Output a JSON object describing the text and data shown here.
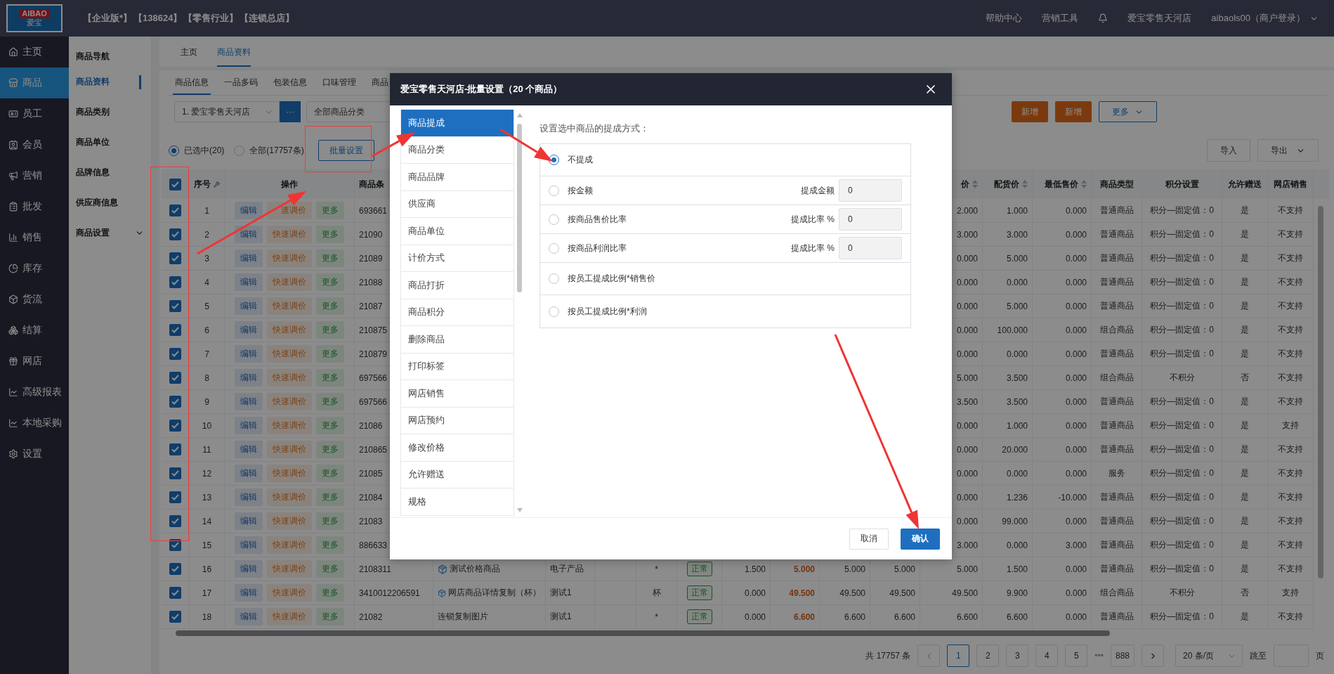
{
  "logo": {
    "text": "AIBAO",
    "subtext": "爱宝"
  },
  "header": {
    "badges": [
      "【企业版*】",
      "【138624】",
      "【零售行业】",
      "【连锁总店】"
    ],
    "links": [
      "帮助中心",
      "营销工具"
    ],
    "store": "爱宝零售天河店",
    "user": "aibaols00（商户登录）"
  },
  "sidebar": {
    "items": [
      {
        "label": "主页",
        "selected": false
      },
      {
        "label": "商品",
        "selected": true
      },
      {
        "label": "员工",
        "selected": false
      },
      {
        "label": "会员",
        "selected": false
      },
      {
        "label": "营销",
        "selected": false
      },
      {
        "label": "批发",
        "selected": false
      },
      {
        "label": "销售",
        "selected": false
      },
      {
        "label": "库存",
        "selected": false
      },
      {
        "label": "货流",
        "selected": false
      },
      {
        "label": "结算",
        "selected": false
      },
      {
        "label": "网店",
        "selected": false
      },
      {
        "label": "高级报表",
        "selected": false
      },
      {
        "label": "本地采购",
        "selected": false
      },
      {
        "label": "设置",
        "selected": false
      }
    ]
  },
  "subnav": {
    "title": "商品导航",
    "items": [
      {
        "label": "商品资料",
        "selected": true,
        "has_children": false
      },
      {
        "label": "商品类别",
        "selected": false,
        "has_children": false
      },
      {
        "label": "商品单位",
        "selected": false,
        "has_children": false
      },
      {
        "label": "品牌信息",
        "selected": false,
        "has_children": false
      },
      {
        "label": "供应商信息",
        "selected": false,
        "has_children": false
      },
      {
        "label": "商品设置",
        "selected": false,
        "has_children": true
      }
    ]
  },
  "page_tabs": [
    {
      "label": "主页",
      "selected": false
    },
    {
      "label": "商品资料",
      "selected": true
    }
  ],
  "inner_tabs": [
    {
      "label": "商品信息",
      "selected": true
    },
    {
      "label": "一品多码",
      "selected": false
    },
    {
      "label": "包装信息",
      "selected": false
    },
    {
      "label": "口味管理",
      "selected": false
    },
    {
      "label": "商品",
      "selected": false
    }
  ],
  "filters": {
    "store_select": "1. 爱宝零售天河店",
    "more_button": "···",
    "category_select": "全部商品分类"
  },
  "action_buttons": [
    {
      "label": "新增",
      "kind": "primary"
    },
    {
      "label": "新增",
      "kind": "primary"
    },
    {
      "label": "更多",
      "kind": "dropdown"
    }
  ],
  "scope": [
    {
      "label": "已选中(20)",
      "selected": true
    },
    {
      "label": "全部(17757条)",
      "selected": false
    }
  ],
  "batch_button": "批量设置",
  "io_buttons": [
    {
      "label": "导入",
      "kind": "plain"
    },
    {
      "label": "导出",
      "kind": "dropdown"
    }
  ],
  "table": {
    "all_checked": true,
    "columns": [
      {
        "label": "序号",
        "kind": "seq"
      },
      {
        "label": "操作",
        "kind": "ops"
      },
      {
        "label": "商品条",
        "kind": "text"
      },
      {
        "kind": "name"
      },
      {
        "kind": "text"
      },
      {
        "kind": "text"
      },
      {
        "kind": "center"
      },
      {
        "kind": "status"
      },
      {
        "kind": "num"
      },
      {
        "kind": "strong"
      },
      {
        "kind": "num"
      },
      {
        "kind": "num"
      },
      {
        "label": "价",
        "kind": "num",
        "sortable": true
      },
      {
        "label": "配货价",
        "kind": "num",
        "sortable": true
      },
      {
        "label": "最低售价",
        "kind": "num",
        "sortable": true
      },
      {
        "label": "商品类型",
        "kind": "center"
      },
      {
        "label": "积分设置",
        "kind": "center"
      },
      {
        "label": "允许赠送",
        "kind": "center"
      },
      {
        "label": "网店销售",
        "kind": "center"
      }
    ],
    "rows": [
      {
        "checked": true,
        "seq": "1",
        "ops": [
          "编辑",
          "速调价",
          "更多"
        ],
        "barcode": "693661",
        "price": "2.000",
        "dist": "1.000",
        "min": "0.000",
        "type": "普通商品",
        "points": "积分—固定值：0",
        "gift": "是",
        "online": "不支持"
      },
      {
        "checked": true,
        "seq": "2",
        "ops": [
          "编辑",
          "快速调价",
          "更多"
        ],
        "barcode": "21090",
        "price": "3.000",
        "dist": "3.000",
        "min": "0.000",
        "type": "普通商品",
        "points": "积分—固定值：0",
        "gift": "是",
        "online": "不支持"
      },
      {
        "checked": true,
        "seq": "3",
        "ops": [
          "编辑",
          "快速调价",
          "更多"
        ],
        "barcode": "21089",
        "price": "0.000",
        "dist": "5.000",
        "min": "0.000",
        "type": "普通商品",
        "points": "积分—固定值：0",
        "gift": "是",
        "online": "不支持"
      },
      {
        "checked": true,
        "seq": "4",
        "ops": [
          "编辑",
          "快速调价",
          "更多"
        ],
        "barcode": "21088",
        "price": "0.000",
        "dist": "0.000",
        "min": "0.000",
        "type": "普通商品",
        "points": "积分—固定值：0",
        "gift": "是",
        "online": "不支持"
      },
      {
        "checked": true,
        "seq": "5",
        "ops": [
          "编辑",
          "快速调价",
          "更多"
        ],
        "barcode": "21087",
        "price": "0.000",
        "dist": "5.000",
        "min": "0.000",
        "type": "普通商品",
        "points": "积分—固定值：0",
        "gift": "是",
        "online": "不支持"
      },
      {
        "checked": true,
        "seq": "6",
        "ops": [
          "编辑",
          "快速调价",
          "更多"
        ],
        "barcode": "210875",
        "price": "0.000",
        "dist": "100.000",
        "min": "0.000",
        "type": "组合商品",
        "points": "积分—固定值：0",
        "gift": "是",
        "online": "不支持"
      },
      {
        "checked": true,
        "seq": "7",
        "ops": [
          "编辑",
          "快速调价",
          "更多"
        ],
        "barcode": "210879",
        "price": "0.000",
        "dist": "0.000",
        "min": "0.000",
        "type": "普通商品",
        "points": "积分—固定值：0",
        "gift": "是",
        "online": "不支持"
      },
      {
        "checked": true,
        "seq": "8",
        "ops": [
          "编辑",
          "快速调价",
          "更多"
        ],
        "barcode": "697566",
        "price": "5.000",
        "dist": "3.500",
        "min": "0.000",
        "type": "组合商品",
        "points": "不积分",
        "gift": "否",
        "online": "不支持"
      },
      {
        "checked": true,
        "seq": "9",
        "ops": [
          "编辑",
          "快速调价",
          "更多"
        ],
        "barcode": "697566",
        "price": "3.500",
        "dist": "3.500",
        "min": "0.000",
        "type": "普通商品",
        "points": "积分—固定值：0",
        "gift": "是",
        "online": "不支持"
      },
      {
        "checked": true,
        "seq": "10",
        "ops": [
          "编辑",
          "快速调价",
          "更多"
        ],
        "barcode": "21086",
        "price": "0.000",
        "dist": "1.000",
        "min": "0.000",
        "type": "普通商品",
        "points": "积分—固定值：0",
        "gift": "是",
        "online": "支持"
      },
      {
        "checked": true,
        "seq": "11",
        "ops": [
          "编辑",
          "快速调价",
          "更多"
        ],
        "barcode": "210865",
        "price": "0.000",
        "dist": "20.000",
        "min": "0.000",
        "type": "普通商品",
        "points": "积分—固定值：0",
        "gift": "是",
        "online": "不支持"
      },
      {
        "checked": true,
        "seq": "12",
        "ops": [
          "编辑",
          "快速调价",
          "更多"
        ],
        "barcode": "21085",
        "price": "0.000",
        "dist": "0.000",
        "min": "0.000",
        "type": "服务",
        "points": "积分—固定值：0",
        "gift": "是",
        "online": "不支持"
      },
      {
        "checked": true,
        "seq": "13",
        "ops": [
          "编辑",
          "快速调价",
          "更多"
        ],
        "barcode": "21084",
        "price": "0.000",
        "dist": "1.236",
        "min": "-10.000",
        "type": "普通商品",
        "points": "积分—固定值：0",
        "gift": "是",
        "online": "不支持"
      },
      {
        "checked": true,
        "seq": "14",
        "ops": [
          "编辑",
          "快速调价",
          "更多"
        ],
        "barcode": "21083",
        "price": "0.000",
        "dist": "99.000",
        "min": "0.000",
        "type": "普通商品",
        "points": "积分—固定值：0",
        "gift": "是",
        "online": "不支持"
      },
      {
        "checked": true,
        "seq": "15",
        "ops": [
          "编辑",
          "快速调价",
          "更多"
        ],
        "barcode": "886633",
        "price": "3.000",
        "dist": "0.000",
        "min": "3.000",
        "type": "普通商品",
        "points": "积分—固定值：0",
        "gift": "是",
        "online": "不支持"
      },
      {
        "checked": true,
        "seq": "16",
        "ops": [
          "编辑",
          "快速调价",
          "更多"
        ],
        "barcode": "2108311",
        "name": "测试价格商品",
        "product_icon": true,
        "category": "电子产品",
        "unit": "*",
        "status": "正常",
        "p1": "1.500",
        "p2": "5.000",
        "p3": "5.000",
        "p4": "5.000",
        "price": "5.000",
        "dist": "1.500",
        "min": "0.000",
        "type": "普通商品",
        "points": "积分—固定值：0",
        "gift": "是",
        "online": "不支持"
      },
      {
        "checked": true,
        "seq": "17",
        "ops": [
          "编辑",
          "快速调价",
          "更多"
        ],
        "barcode": "3410012206591",
        "name": "网店商品详情复制（杯）",
        "product_icon": true,
        "category": "测试1",
        "unit": "杯",
        "status": "正常",
        "p1": "0.000",
        "p2": "49.500",
        "p3": "49.500",
        "p4": "49.500",
        "price": "49.500",
        "dist": "9.900",
        "min": "0.000",
        "type": "组合商品",
        "points": "不积分",
        "gift": "否",
        "online": "支持"
      },
      {
        "checked": true,
        "seq": "18",
        "ops": [
          "编辑",
          "快速调价",
          "更多"
        ],
        "barcode": "21082",
        "name": "连锁复制图片",
        "product_icon": false,
        "category": "测试1",
        "unit": "*",
        "status": "正常",
        "p1": "0.000",
        "p2": "6.600",
        "p3": "6.600",
        "p4": "6.600",
        "price": "6.600",
        "dist": "6.600",
        "min": "0.000",
        "type": "普通商品",
        "points": "积分—固定值：0",
        "gift": "是",
        "online": "不支持"
      }
    ]
  },
  "pagination": {
    "total": "共 17757 条",
    "pages": [
      {
        "label": "1",
        "selected": true
      },
      {
        "label": "2",
        "selected": false
      },
      {
        "label": "3",
        "selected": false
      },
      {
        "label": "4",
        "selected": false
      },
      {
        "label": "5",
        "selected": false
      },
      {
        "label": "888",
        "selected": false
      }
    ],
    "ellipsis": "•••",
    "page_size": "20 条/页",
    "jump_label": "跳至",
    "jump_suffix": "页"
  },
  "dialog": {
    "title": "爱宝零售天河店-批量设置（20 个商品）",
    "menu": [
      {
        "label": "商品提成",
        "selected": true
      },
      {
        "label": "商品分类",
        "selected": false
      },
      {
        "label": "商品品牌",
        "selected": false
      },
      {
        "label": "供应商",
        "selected": false
      },
      {
        "label": "商品单位",
        "selected": false
      },
      {
        "label": "计价方式",
        "selected": false
      },
      {
        "label": "商品打折",
        "selected": false
      },
      {
        "label": "商品积分",
        "selected": false
      },
      {
        "label": "删除商品",
        "selected": false
      },
      {
        "label": "打印标签",
        "selected": false
      },
      {
        "label": "网店销售",
        "selected": false
      },
      {
        "label": "网店预约",
        "selected": false
      },
      {
        "label": "修改价格",
        "selected": false
      },
      {
        "label": "允许赠送",
        "selected": false
      },
      {
        "label": "规格",
        "selected": false
      }
    ],
    "prompt": "设置选中商品的提成方式：",
    "options": [
      {
        "label": "不提成",
        "selected": true
      },
      {
        "label": "按金额",
        "selected": false,
        "field_label": "提成金额",
        "value": "0"
      },
      {
        "label": "按商品售价比率",
        "selected": false,
        "field_label": "提成比率 %",
        "value": "0"
      },
      {
        "label": "按商品利润比率",
        "selected": false,
        "field_label": "提成比率 %",
        "value": "0"
      },
      {
        "label": "按员工提成比例*销售价",
        "selected": false
      },
      {
        "label": "按员工提成比例*利润",
        "selected": false
      }
    ],
    "buttons": [
      {
        "label": "取消",
        "kind": "secondary"
      },
      {
        "label": "确认",
        "kind": "primary"
      }
    ]
  }
}
